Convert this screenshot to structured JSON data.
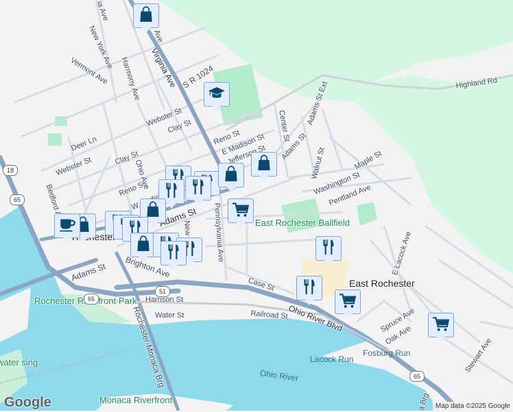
{
  "map": {
    "attribution": "Map data ©2025 Google",
    "logo": "Google",
    "colors": {
      "land": "#f4f3f4",
      "forest": "#d4f6e3",
      "park": "#b3ebcb",
      "water": "#8fd9ed",
      "highway": "#8ba6c3",
      "road": "#d5dce6",
      "marker_bg": "#e3edfc",
      "marker_icon": "#0b4a6c"
    },
    "place_labels": {
      "east_rochester": "East Rochester",
      "rochester": "Rochester",
      "ballfield": "East Rochester Ballfield",
      "riverfront_park": "Rochester Riverfront Park",
      "bridgewater_landing": "water sing",
      "monaca_riverfront": "Monaca Riverfront",
      "ohio_river": "Ohio River",
      "lacock_run": "Lacock Run",
      "fosburg_run": "Fosburg Run"
    },
    "street_labels": {
      "virginia_ave": "Virginia Ave",
      "virginia_ave_top": "Ave",
      "top_ave": "ia Ave",
      "sr1024": "S R 1024",
      "new_york_ave": "New York Ave",
      "vermont_ave": "Vermont Ave",
      "harmony_ave": "Harmony Ave",
      "webster_st_1": "Webster St",
      "webster_st_2": "Webster St",
      "clay_st_1": "Clay St",
      "clay_st_2": "Clay St",
      "deer_ln": "Deer Ln",
      "reno_st_1": "Reno St",
      "reno_st_2": "Reno St",
      "ohio_ave": "Ohio Ave",
      "e_madison_st": "E Madison St",
      "jefferson_st": "Jefferson St",
      "w_madison": "W Madison",
      "bedford": "Bedford Ave",
      "adams_st_1": "Adams St",
      "adams_st_2": "Adams St",
      "adams_st_3": "Adams St",
      "adams_st_ext": "Adams St Ext",
      "center_st": "Center St",
      "walnut_st": "Walnut St",
      "maple_st": "Maple St",
      "washington_st": "Washington St",
      "pentland_ave": "Pentland Ave",
      "highland_rd": "Highland Rd",
      "pennsylvania_ave": "Pennsylvania Ave",
      "new": "New",
      "brighton_ave": "Brighton Ave",
      "case_st": "Case St",
      "harrison_st": "Harrison St",
      "water_st": "Water St",
      "railroad_st": "Railroad St",
      "ohio_river_blvd": "Ohio River Blvd",
      "rochester_monaca_brg": "Rochester-Monaca Brg",
      "e_lacock_ave": "E Lacock Ave",
      "spruce_ave": "Spruce Ave",
      "oak_ave": "Oak Ave",
      "stewart_ave": "Stewart Ave",
      "brg": "a Brg"
    },
    "route_shields": {
      "r18": "18",
      "r65a": "65",
      "r65b": "65",
      "r51": "51",
      "r65c": "65"
    },
    "markers": [
      {
        "type": "shopping",
        "icon": "shopping-bag-icon"
      },
      {
        "type": "school",
        "icon": "graduation-cap-icon"
      },
      {
        "type": "restaurant",
        "icon": "fork-knife-icon"
      },
      {
        "type": "restaurant",
        "icon": "fork-knife-icon"
      },
      {
        "type": "restaurant",
        "icon": "fork-knife-icon"
      },
      {
        "type": "restaurant",
        "icon": "fork-knife-icon"
      },
      {
        "type": "shopping",
        "icon": "shopping-bag-icon"
      },
      {
        "type": "shopping",
        "icon": "shopping-bag-icon"
      },
      {
        "type": "grocery",
        "icon": "shopping-cart-icon"
      },
      {
        "type": "shopping",
        "icon": "shopping-bag-icon"
      },
      {
        "type": "shopping",
        "icon": "shopping-bag-icon"
      },
      {
        "type": "cafe",
        "icon": "coffee-cup-icon"
      },
      {
        "type": "restaurant",
        "icon": "fork-knife-icon"
      },
      {
        "type": "restaurant",
        "icon": "fork-knife-icon"
      },
      {
        "type": "restaurant",
        "icon": "fork-knife-icon"
      },
      {
        "type": "shopping",
        "icon": "shopping-bag-icon"
      },
      {
        "type": "restaurant",
        "icon": "fork-knife-icon"
      },
      {
        "type": "restaurant",
        "icon": "fork-knife-icon"
      },
      {
        "type": "restaurant",
        "icon": "fork-knife-icon"
      },
      {
        "type": "restaurant",
        "icon": "fork-knife-icon"
      },
      {
        "type": "restaurant",
        "icon": "fork-knife-icon"
      },
      {
        "type": "grocery",
        "icon": "shopping-cart-icon"
      },
      {
        "type": "grocery",
        "icon": "shopping-cart-icon"
      }
    ]
  }
}
